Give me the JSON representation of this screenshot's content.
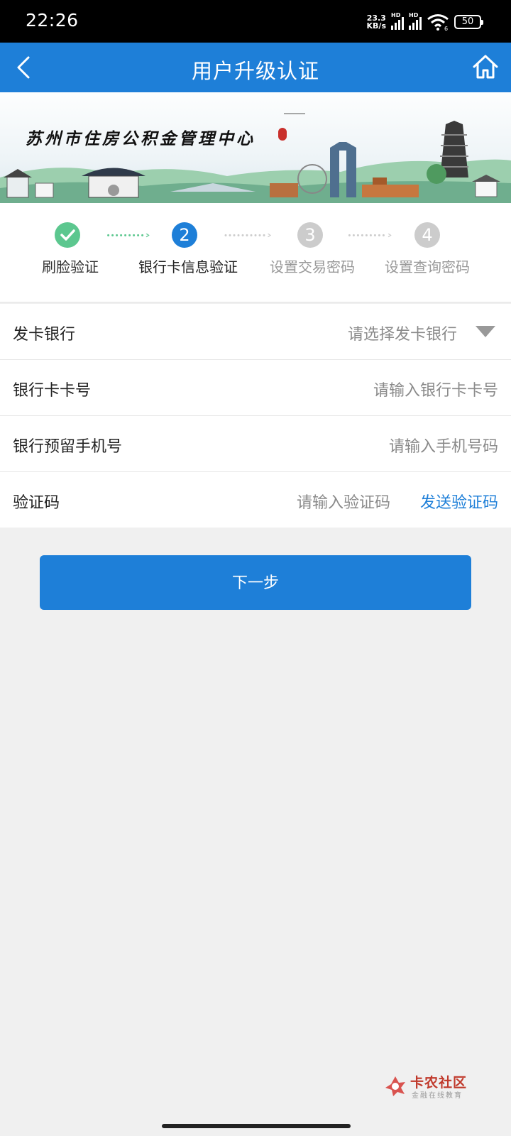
{
  "status_bar": {
    "time": "22:26",
    "net_speed_value": "23.3",
    "net_speed_unit": "KB/s",
    "sim1_label": "HD",
    "sim2_label": "HD",
    "wifi_label": "6",
    "battery": "50"
  },
  "nav": {
    "title": "用户升级认证",
    "back_icon": "chevron-left-icon",
    "home_icon": "home-icon"
  },
  "banner": {
    "title": "苏州市住房公积金管理中心"
  },
  "steps": [
    {
      "number": "",
      "label": "刷脸验证",
      "state": "done"
    },
    {
      "number": "2",
      "label": "银行卡信息验证",
      "state": "active"
    },
    {
      "number": "3",
      "label": "设置交易密码",
      "state": "pending"
    },
    {
      "number": "4",
      "label": "设置查询密码",
      "state": "pending"
    }
  ],
  "form": {
    "bank": {
      "label": "发卡银行",
      "placeholder": "请选择发卡银行"
    },
    "card_number": {
      "label": "银行卡卡号",
      "placeholder": "请输入银行卡卡号"
    },
    "phone": {
      "label": "银行预留手机号",
      "placeholder": "请输入手机号码"
    },
    "code": {
      "label": "验证码",
      "placeholder": "请输入验证码",
      "send_label": "发送验证码"
    }
  },
  "next_button": "下一步",
  "watermark": {
    "name": "卡农社区",
    "sub": "金融在线教育"
  },
  "colors": {
    "primary": "#1e7fd8",
    "done_green": "#5cc78f",
    "pending_gray": "#cccccc"
  }
}
